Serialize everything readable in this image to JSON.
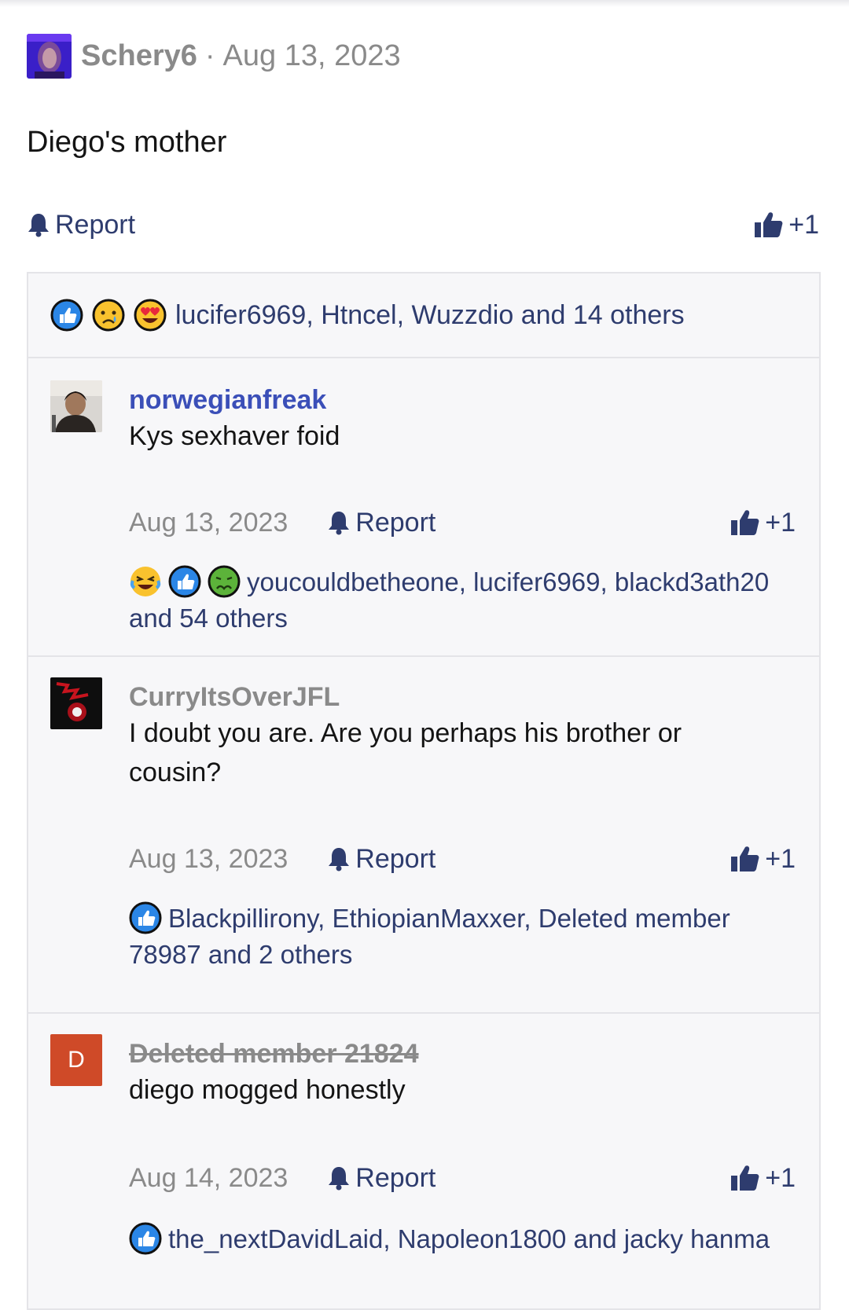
{
  "post": {
    "author": "Schery6",
    "separator": "·",
    "date": "Aug 13, 2023",
    "body": "Diego's mother",
    "report_label": "Report",
    "like_label": "+1",
    "reactions_text": "lucifer6969, Htncel, Wuzzdio and 14 others"
  },
  "comments": [
    {
      "author": "norwegianfreak",
      "text": "Kys sexhaver foid",
      "date": "Aug 13, 2023",
      "report_label": "Report",
      "like_label": "+1",
      "reactions_text": "youcouldbetheone, lucifer6969, blackd3ath20 and 54 others"
    },
    {
      "author": "CurryItsOverJFL",
      "text": "I doubt you are. Are you perhaps his brother or cousin?",
      "date": "Aug 13, 2023",
      "report_label": "Report",
      "like_label": "+1",
      "reactions_text": "Blackpillirony, EthiopianMaxxer, Deleted member 78987 and 2 others"
    },
    {
      "author": "Deleted member 21824",
      "avatar_letter": "D",
      "text": "diego mogged honestly",
      "date": "Aug 14, 2023",
      "report_label": "Report",
      "like_label": "+1",
      "reactions_text": "the_nextDavidLaid, Napoleon1800 and jacky hanma"
    }
  ],
  "colors": {
    "link": "#2e3c6e",
    "author_link": "#3b4fb8",
    "muted": "#8a8a8a",
    "like_blue": "#2b86e6",
    "deleted_avatar": "#cf4a28"
  },
  "icons": [
    "bell-icon",
    "thumbs-up-icon",
    "like-reaction-icon",
    "sad-reaction-icon",
    "love-reaction-icon",
    "laugh-reaction-icon",
    "sick-reaction-icon"
  ]
}
